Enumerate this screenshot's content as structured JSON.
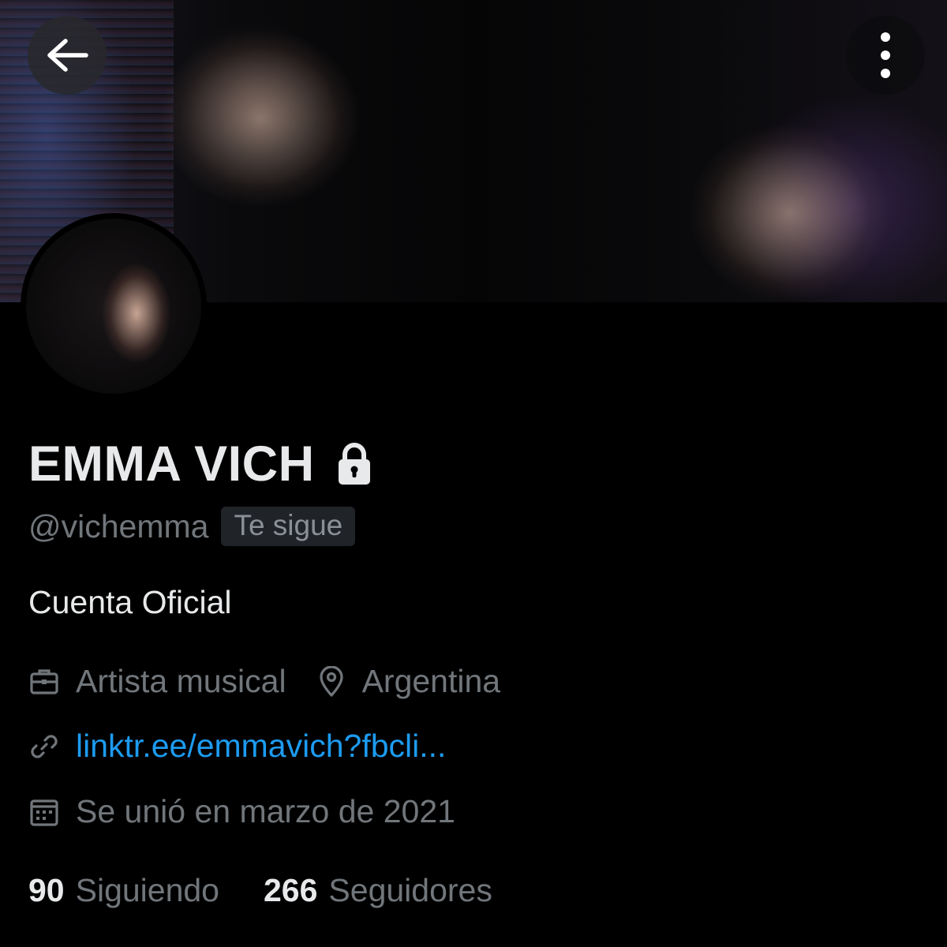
{
  "profile": {
    "name": "EMMA VICH",
    "handle": "@vichemma",
    "follows_you_label": "Te sigue",
    "bio": "Cuenta Oficial",
    "category": "Artista musical",
    "location": "Argentina",
    "website": "linktr.ee/emmavich?fbcli...",
    "joined": "Se unió en marzo de 2021",
    "protected_icon": "lock-icon"
  },
  "stats": {
    "following_count": "90",
    "following_label": "Siguiendo",
    "followers_count": "266",
    "followers_label": "Seguidores"
  },
  "icons": {
    "back": "back-arrow-icon",
    "more": "more-vertical-icon",
    "category": "briefcase-icon",
    "location": "location-pin-icon",
    "website": "link-icon",
    "joined": "calendar-icon"
  },
  "colors": {
    "background": "#000000",
    "text_primary": "#e7e9ea",
    "text_secondary": "#71767b",
    "link": "#1d9bf0",
    "badge_bg": "#202327"
  }
}
